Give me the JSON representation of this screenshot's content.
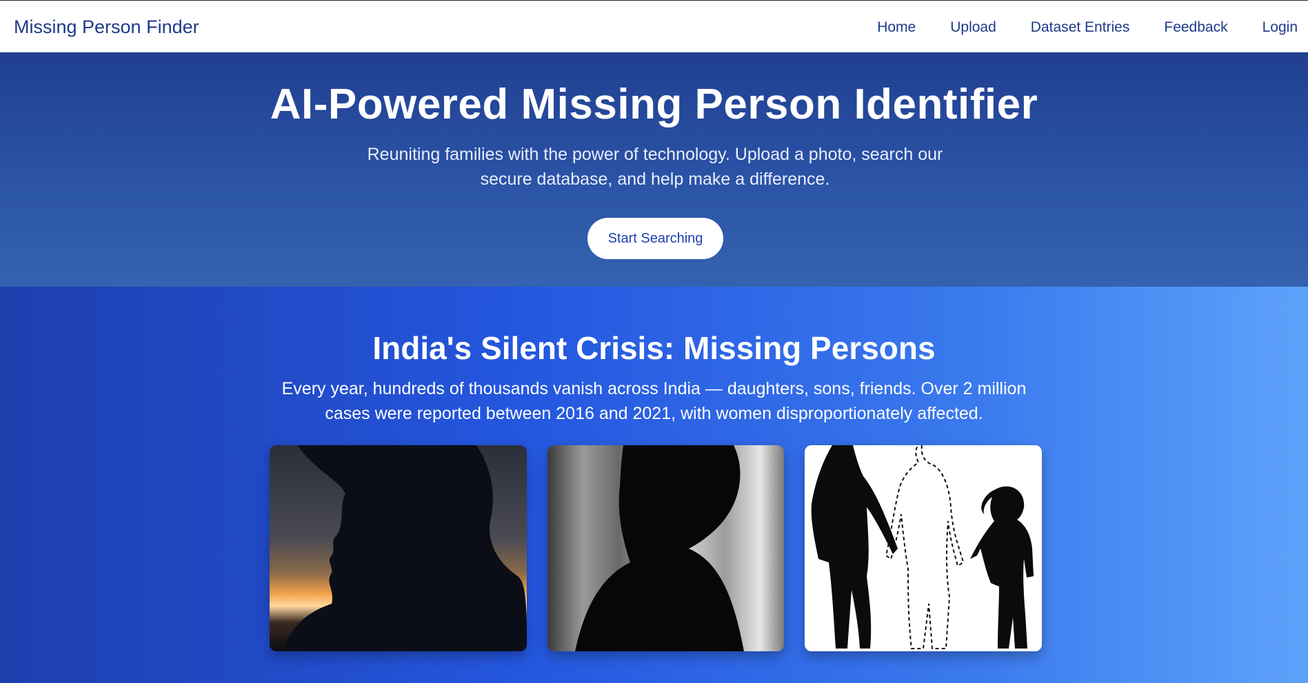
{
  "navbar": {
    "brand": "Missing Person Finder",
    "links": [
      "Home",
      "Upload",
      "Dataset Entries",
      "Feedback",
      "Login"
    ]
  },
  "hero": {
    "title": "AI-Powered Missing Person Identifier",
    "subtitle": "Reuniting families with the power of technology. Upload a photo, search our secure database, and help make a difference.",
    "cta_label": "Start Searching"
  },
  "crisis": {
    "title": "India's Silent Crisis: Missing Persons",
    "text": "Every year, hundreds of thousands vanish across India — daughters, sons, friends. Over 2 million cases were reported between 2016 and 2021, with women disproportionately affected."
  },
  "colors": {
    "brand": "#1e3a8a",
    "hero_bg": "#2c55a8",
    "crisis_gradient_start": "#1e3eae",
    "crisis_gradient_end": "#5fa2fb"
  }
}
